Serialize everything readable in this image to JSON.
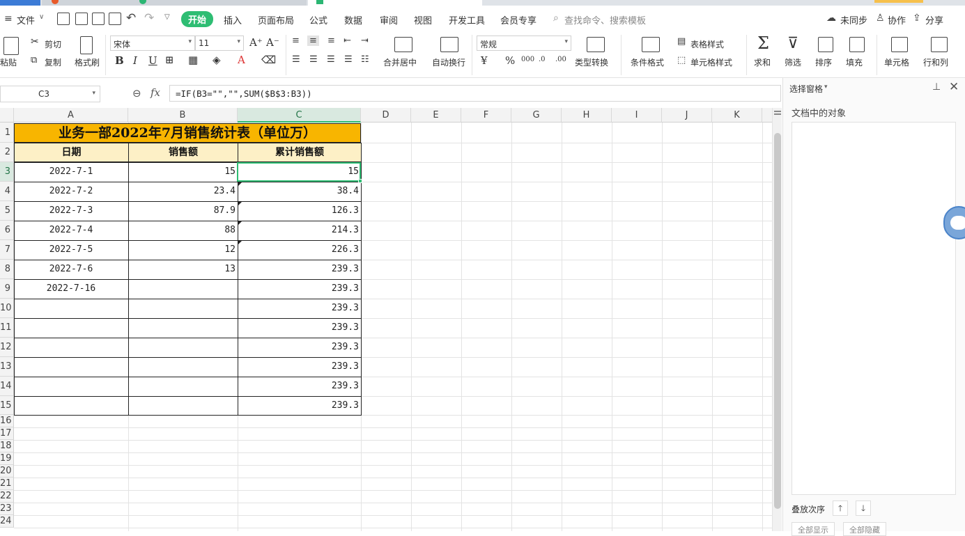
{
  "menubar": {
    "file": "文件",
    "tabs": [
      "开始",
      "插入",
      "页面布局",
      "公式",
      "数据",
      "审阅",
      "视图",
      "开发工具",
      "会员专享"
    ],
    "active_tab": "开始",
    "search_placeholder": "查找命令、搜索模板",
    "sync": "未同步",
    "collab": "协作",
    "share": "分享"
  },
  "ribbon": {
    "paste": "粘贴",
    "cut": "剪切",
    "copy": "复制",
    "format_painter": "格式刷",
    "font_name": "宋体",
    "font_size": "11",
    "number_format": "常规",
    "merge_center": "合并居中",
    "wrap_text": "自动换行",
    "type_convert": "类型转换",
    "cond_format": "条件格式",
    "table_style": "表格样式",
    "cell_style": "单元格样式",
    "sum": "求和",
    "filter": "筛选",
    "sort": "排序",
    "fill": "填充",
    "cell": "单元格",
    "row_col": "行和列"
  },
  "formula_bar": {
    "name_box": "C3",
    "fx": "fx",
    "formula": "=IF(B3=\"\",\"\",SUM($B$3:B3))"
  },
  "sheet": {
    "columns": [
      "A",
      "B",
      "C",
      "D",
      "E",
      "F",
      "G",
      "H",
      "I",
      "J",
      "K"
    ],
    "rows": [
      "1",
      "2",
      "3",
      "4",
      "5",
      "6",
      "7",
      "8",
      "9",
      "10",
      "11",
      "12",
      "13",
      "14",
      "15",
      "16",
      "17",
      "18",
      "19",
      "20",
      "21",
      "22",
      "23",
      "24"
    ],
    "title": "业务一部2022年7月销售统计表（单位万）",
    "headers": [
      "日期",
      "销售额",
      "累计销售额"
    ],
    "data": [
      [
        "2022-7-1",
        "15",
        "15"
      ],
      [
        "2022-7-2",
        "23.4",
        "38.4"
      ],
      [
        "2022-7-3",
        "87.9",
        "126.3"
      ],
      [
        "2022-7-4",
        "88",
        "214.3"
      ],
      [
        "2022-7-5",
        "12",
        "226.3"
      ],
      [
        "2022-7-6",
        "13",
        "239.3"
      ],
      [
        "2022-7-16",
        "",
        "239.3"
      ],
      [
        "",
        "",
        "239.3"
      ],
      [
        "",
        "",
        "239.3"
      ],
      [
        "",
        "",
        "239.3"
      ],
      [
        "",
        "",
        "239.3"
      ],
      [
        "",
        "",
        "239.3"
      ],
      [
        "",
        "",
        "239.3"
      ]
    ],
    "selected_cell": "C3"
  },
  "panel": {
    "title": "选择窗格",
    "subtitle": "文档中的对象",
    "order": "叠放次序",
    "show_all": "全部显示",
    "hide_all": "全部隐藏"
  },
  "colors": {
    "accent": "#2ebd73",
    "title_fill": "#f8b500",
    "header_fill": "#fdf0c6"
  }
}
